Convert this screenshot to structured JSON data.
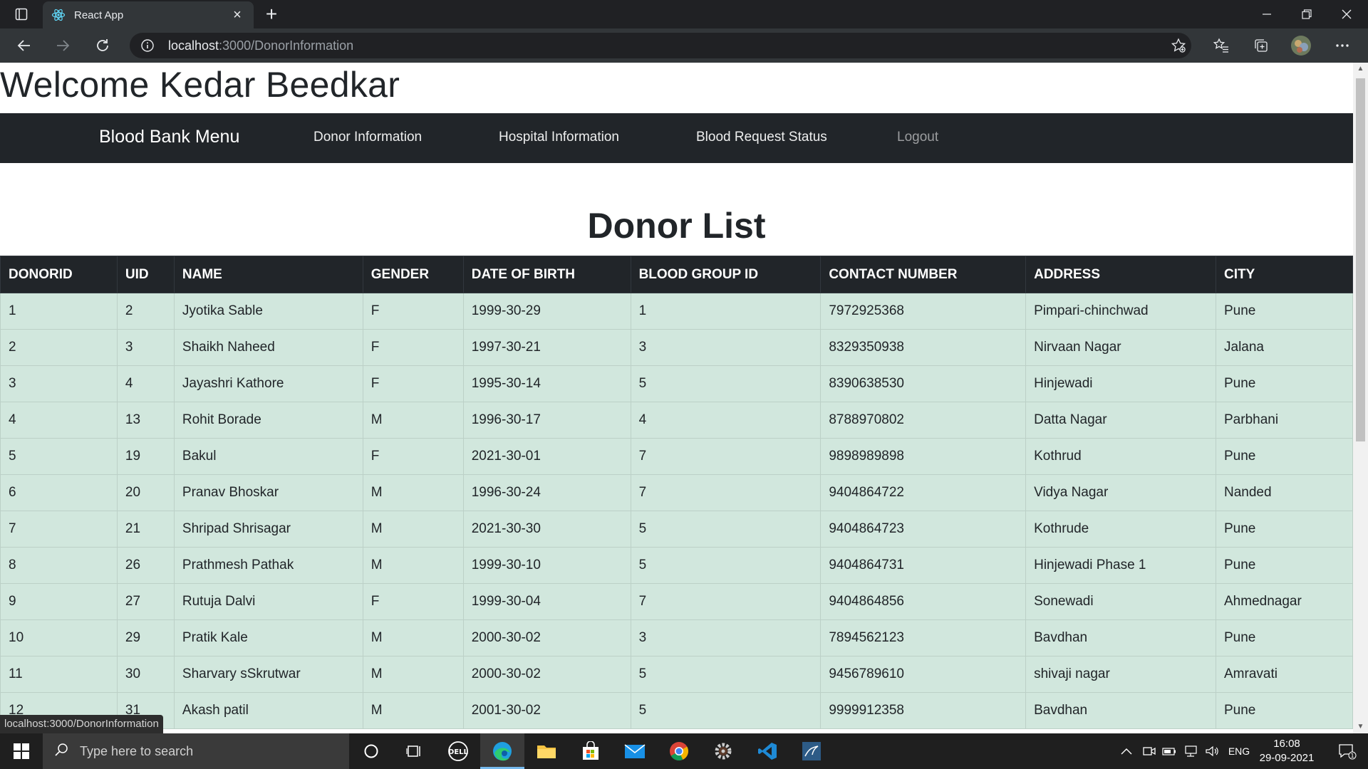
{
  "browser": {
    "tab_title": "React App",
    "tab_close": "×",
    "new_tab": "+",
    "url_host": "localhost",
    "url_path": ":3000/DonorInformation"
  },
  "page": {
    "welcome": "Welcome Kedar Beedkar",
    "nav": {
      "brand": "Blood Bank Menu",
      "donor_information": "Donor Information",
      "hospital_information": "Hospital Information",
      "blood_request_status": "Blood Request Status",
      "logout": "Logout"
    },
    "heading": "Donor List",
    "table": {
      "columns": [
        "DONORID",
        "UID",
        "NAME",
        "GENDER",
        "DATE OF BIRTH",
        "BLOOD GROUP ID",
        "CONTACT NUMBER",
        "ADDRESS",
        "CITY"
      ],
      "rows": [
        [
          "1",
          "2",
          "Jyotika Sable",
          "F",
          "1999-30-29",
          "1",
          "7972925368",
          "Pimpari-chinchwad",
          "Pune"
        ],
        [
          "2",
          "3",
          "Shaikh Naheed",
          "F",
          "1997-30-21",
          "3",
          "8329350938",
          "Nirvaan Nagar",
          "Jalana"
        ],
        [
          "3",
          "4",
          "Jayashri Kathore",
          "F",
          "1995-30-14",
          "5",
          "8390638530",
          "Hinjewadi",
          "Pune"
        ],
        [
          "4",
          "13",
          "Rohit Borade",
          "M",
          "1996-30-17",
          "4",
          "8788970802",
          "Datta Nagar",
          "Parbhani"
        ],
        [
          "5",
          "19",
          "Bakul",
          "F",
          "2021-30-01",
          "7",
          "9898989898",
          "Kothrud",
          "Pune"
        ],
        [
          "6",
          "20",
          "Pranav Bhoskar",
          "M",
          "1996-30-24",
          "7",
          "9404864722",
          "Vidya Nagar",
          "Nanded"
        ],
        [
          "7",
          "21",
          "Shripad Shrisagar",
          "M",
          "2021-30-30",
          "5",
          "9404864723",
          "Kothrude",
          "Pune"
        ],
        [
          "8",
          "26",
          "Prathmesh Pathak",
          "M",
          "1999-30-10",
          "5",
          "9404864731",
          "Hinjewadi Phase 1",
          "Pune"
        ],
        [
          "9",
          "27",
          "Rutuja Dalvi",
          "F",
          "1999-30-04",
          "7",
          "9404864856",
          "Sonewadi",
          "Ahmednagar"
        ],
        [
          "10",
          "29",
          "Pratik Kale",
          "M",
          "2000-30-02",
          "3",
          "7894562123",
          "Bavdhan",
          "Pune"
        ],
        [
          "11",
          "30",
          "Sharvary sSkrutwar",
          "M",
          "2000-30-02",
          "5",
          "9456789610",
          "shivaji nagar",
          "Amravati"
        ],
        [
          "12",
          "31",
          "Akash patil",
          "M",
          "2001-30-02",
          "5",
          "9999912358",
          "Bavdhan",
          "Pune"
        ]
      ]
    },
    "status_url": "localhost:3000/DonorInformation"
  },
  "taskbar": {
    "search_placeholder": "Type here to search",
    "language": "ENG",
    "time": "16:08",
    "date": "29-09-2021",
    "notification_count": "1"
  },
  "colors": {
    "navbar_bg": "#212529",
    "row_bg": "#d1e7dd",
    "chrome_bg": "#202124"
  }
}
